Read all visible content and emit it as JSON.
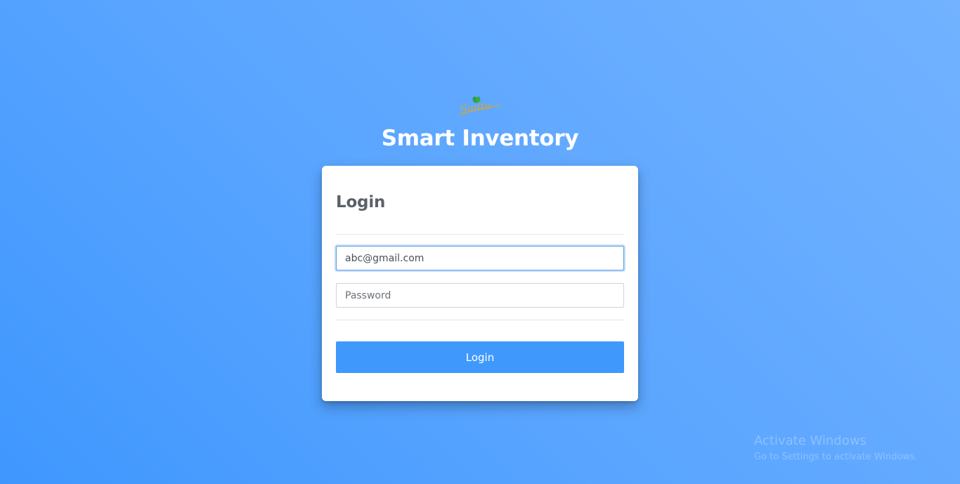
{
  "header": {
    "logo_text": "Santo",
    "title": "Smart Inventory"
  },
  "login_card": {
    "title": "Login",
    "email_value": "abc@gmail.com",
    "password_placeholder": "Password",
    "button_label": "Login"
  },
  "watermark": {
    "title": "Activate Windows",
    "subtitle": "Go to Settings to activate Windows."
  },
  "colors": {
    "background": "#4ea0fe",
    "button": "#3f99fd",
    "logo_leaf": "#2e9e3f",
    "logo_text": "#c9a845"
  }
}
